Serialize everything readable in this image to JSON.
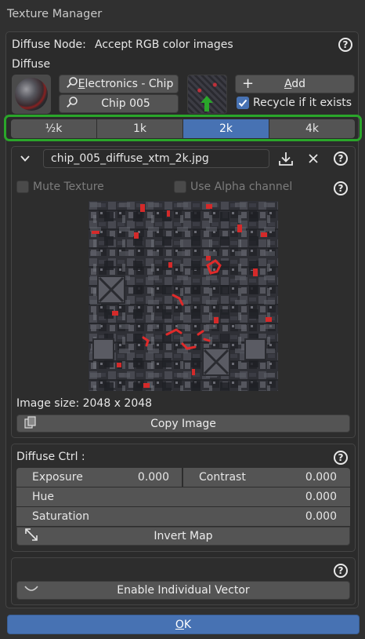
{
  "window": {
    "title": "Texture Manager"
  },
  "header": {
    "node_label": "Diffuse Node:",
    "node_desc": "Accept RGB color images",
    "section": "Diffuse"
  },
  "search": {
    "category": "Electronics - Chip",
    "asset": "Chip 005"
  },
  "actions": {
    "add_label": "Add",
    "recycle_label": "Recycle if it exists",
    "recycle_checked": true
  },
  "resolutions": {
    "options": [
      "½k",
      "1k",
      "2k",
      "4k"
    ],
    "selected": "2k"
  },
  "image": {
    "filename": "chip_005_diffuse_xtm_2k.jpg",
    "mute_label": "Mute Texture",
    "alpha_label": "Use Alpha channel",
    "size_text": "Image size: 2048 x 2048",
    "copy_label": "Copy Image"
  },
  "ctrl": {
    "title": "Diffuse Ctrl :",
    "exposure": {
      "label": "Exposure",
      "value": "0.000"
    },
    "contrast": {
      "label": "Contrast",
      "value": "0.000"
    },
    "hue": {
      "label": "Hue",
      "value": "0.000"
    },
    "saturation": {
      "label": "Saturation",
      "value": "0.000"
    },
    "invert_label": "Invert Map"
  },
  "vector": {
    "label": "Enable Individual Vector"
  },
  "footer": {
    "ok_label": "OK"
  },
  "colors": {
    "accent": "#4772b3",
    "highlight": "#2aa62a",
    "panel": "#2b2b2b"
  }
}
